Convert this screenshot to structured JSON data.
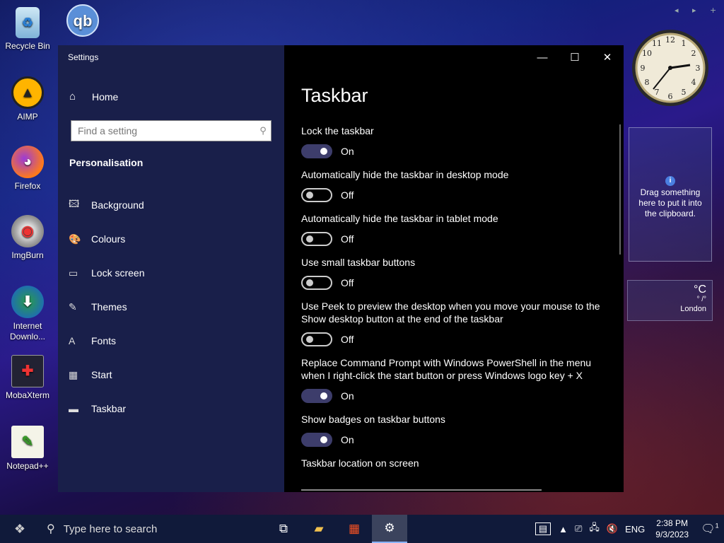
{
  "desktop": {
    "icons": [
      {
        "label": "Recycle Bin",
        "icon": "recycle-bin-icon"
      },
      {
        "label": "AIMP",
        "icon": "aimp-icon"
      },
      {
        "label": "Firefox",
        "icon": "firefox-icon"
      },
      {
        "label": "ImgBurn",
        "icon": "imgburn-icon"
      },
      {
        "label": "Internet Downlo...",
        "icon": "internet-download-manager-icon"
      },
      {
        "label": "MobaXterm",
        "icon": "mobaxterm-icon"
      },
      {
        "label": "Notepad++",
        "icon": "notepadpp-icon"
      }
    ],
    "qbittorrent_glyph": "qb"
  },
  "window": {
    "title": "Settings",
    "caption": {
      "minimize": "—",
      "maximize": "☐",
      "close": "✕"
    }
  },
  "sidebar": {
    "home_label": "Home",
    "search_placeholder": "Find a setting",
    "section_title": "Personalisation",
    "items": [
      {
        "label": "Background",
        "icon": "background-icon",
        "glyph": "🖾"
      },
      {
        "label": "Colours",
        "icon": "palette-icon",
        "glyph": "🎨"
      },
      {
        "label": "Lock screen",
        "icon": "lock-screen-icon",
        "glyph": "▭"
      },
      {
        "label": "Themes",
        "icon": "themes-icon",
        "glyph": "✎"
      },
      {
        "label": "Fonts",
        "icon": "fonts-icon",
        "glyph": "A"
      },
      {
        "label": "Start",
        "icon": "start-icon",
        "glyph": "▦"
      },
      {
        "label": "Taskbar",
        "icon": "taskbar-icon",
        "glyph": "▬"
      }
    ]
  },
  "content": {
    "title": "Taskbar",
    "settings": [
      {
        "label": "Lock the taskbar",
        "state": "On",
        "on": true
      },
      {
        "label": "Automatically hide the taskbar in desktop mode",
        "state": "Off",
        "on": false
      },
      {
        "label": "Automatically hide the taskbar in tablet mode",
        "state": "Off",
        "on": false
      },
      {
        "label": "Use small taskbar buttons",
        "state": "Off",
        "on": false
      },
      {
        "label": "Use Peek to preview the desktop when you move your mouse to the Show desktop button at the end of the taskbar",
        "state": "Off",
        "on": false
      },
      {
        "label": "Replace Command Prompt with Windows PowerShell in the menu when I right-click the start button or press Windows logo key + X",
        "state": "On",
        "on": true
      },
      {
        "label": "Show badges on taskbar buttons",
        "state": "On",
        "on": true
      }
    ],
    "location_label": "Taskbar location on screen"
  },
  "gadgets": {
    "clipboard_text": "Drag something here to put it into the clipboard.",
    "weather_unit": "°C",
    "weather_value": "° /°",
    "weather_city": "London"
  },
  "taskbar": {
    "search_placeholder": "Type here to search",
    "language": "ENG",
    "time": "2:38 PM",
    "date": "9/3/2023",
    "notification_count": "1"
  }
}
